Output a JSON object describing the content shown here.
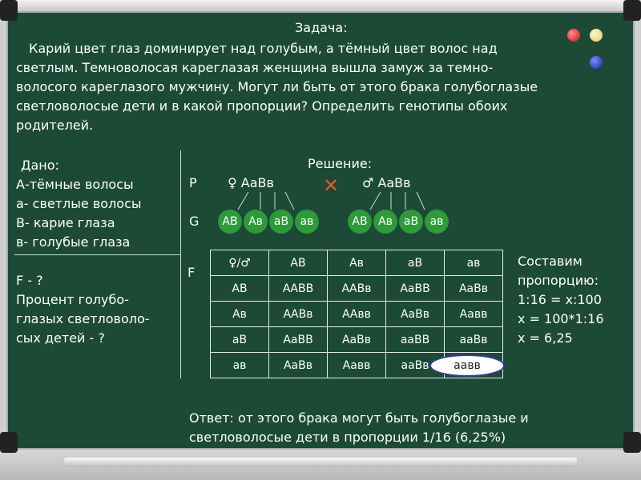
{
  "task": {
    "title": "Задача:",
    "lines": [
      "Карий цвет глаз доминирует над голубым, а тёмный цвет волос над",
      "светлым. Темноволосая кареглазая женщина вышла замуж за темно-",
      "волосого кареглазого мужчину. Могут ли быть от этого брака голубоглазые",
      "светловолосые дети и в какой пропорции? Определить генотипы обоих",
      "родителей."
    ]
  },
  "given": {
    "title": "Дано:",
    "items": [
      "А-тёмные волосы",
      "а- светлые волосы",
      "В- карие глаза",
      "в- голубые глаза"
    ],
    "find": [
      "F - ?",
      "Процент голубо-",
      "глазых светловоло-",
      "сых детей - ?"
    ]
  },
  "solution": {
    "title": "Решение:",
    "p_label": "P",
    "g_label": "G",
    "f_label": "F",
    "female": "♀ АаВв",
    "male": "♂ АаВв",
    "cross": "✕",
    "gametes_female": [
      "АВ",
      "Ав",
      "аВ",
      "ав"
    ],
    "gametes_male": [
      "АВ",
      "Ав",
      "аВ",
      "ав"
    ]
  },
  "table": {
    "header": [
      "♀/♂",
      "АВ",
      "Ав",
      "аВ",
      "ав"
    ],
    "rows": [
      [
        "АВ",
        "ААВВ",
        "ААВв",
        "АаВВ",
        "АаВв"
      ],
      [
        "Ав",
        "ААВв",
        "ААвв",
        "АаВв",
        "Аавв"
      ],
      [
        "аВ",
        "АаВВ",
        "АаВв",
        "ааВВ",
        "ааВв"
      ],
      [
        "ав",
        "АаВв",
        "Аавв",
        "ааВв",
        "аавв"
      ]
    ]
  },
  "proportion": [
    "Составим",
    "пропорцию:",
    "1:16 = x:100",
    "x = 100*1:16",
    "x = 6,25"
  ],
  "answer": [
    "Ответ: от этого брака могут быть голубоглазые и",
    "светловолосые дети в пропорции 1/16 (6,25%)"
  ]
}
